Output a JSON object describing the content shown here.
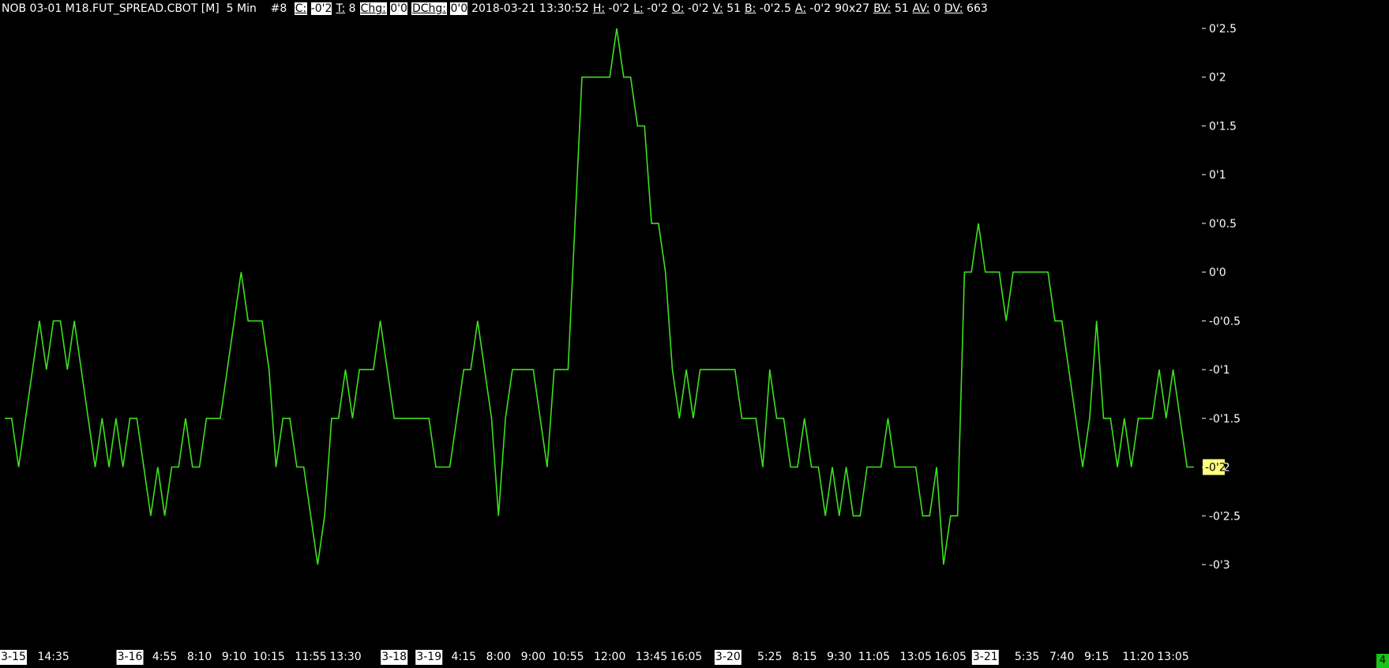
{
  "header": {
    "symbol": "NOB 03-01 M18.FUT_SPREAD.CBOT [M]",
    "interval": "5 Min",
    "bar_num": "#8",
    "items": [
      {
        "label": "C:",
        "value": "-0'2",
        "hl": true
      },
      {
        "label": "T:",
        "value": "8",
        "hl": false
      },
      {
        "label": "Chg:",
        "value": "0'0",
        "hl": true
      },
      {
        "label": "DChg:",
        "value": "0'0",
        "hl": true
      },
      {
        "label": "",
        "value": "2018-03-21 13:30:52",
        "hl": false
      },
      {
        "label": "H:",
        "value": "-0'2",
        "hl": false
      },
      {
        "label": "L:",
        "value": "-0'2",
        "hl": false
      },
      {
        "label": "O:",
        "value": "-0'2",
        "hl": false
      },
      {
        "label": "V:",
        "value": "51",
        "hl": false
      },
      {
        "label": "B:",
        "value": "-0'2.5",
        "hl": false
      },
      {
        "label": "A:",
        "value": "-0'2",
        "hl": false
      },
      {
        "label": "",
        "value": "90x27",
        "hl": false
      },
      {
        "label": "BV:",
        "value": "51",
        "hl": false
      },
      {
        "label": "AV:",
        "value": "0",
        "hl": false
      },
      {
        "label": "DV:",
        "value": "663",
        "hl": false
      }
    ]
  },
  "colors": {
    "line": "#3de01f",
    "background": "#000000",
    "last_price_bg": "#ffff80",
    "badge": "#18c418"
  },
  "badge": "4",
  "chart_data": {
    "type": "line",
    "ylim": [
      -3,
      2.5
    ],
    "y_ticks": [
      {
        "v": 2.5,
        "label": "0'2.5"
      },
      {
        "v": 2,
        "label": "0'2"
      },
      {
        "v": 1.5,
        "label": "0'1.5"
      },
      {
        "v": 1,
        "label": "0'1"
      },
      {
        "v": 0.5,
        "label": "0'0.5"
      },
      {
        "v": 0,
        "label": "0'0"
      },
      {
        "v": -0.5,
        "label": "-0'0.5"
      },
      {
        "v": -1,
        "label": "-0'1"
      },
      {
        "v": -1.5,
        "label": "-0'1.5"
      },
      {
        "v": -2,
        "label": "-0'2"
      },
      {
        "v": -2.5,
        "label": "-0'2.5"
      },
      {
        "v": -3,
        "label": "-0'3"
      }
    ],
    "last_price": {
      "v": -2,
      "label": "-0'2"
    },
    "x_labels": [
      {
        "i": 0,
        "label": "3-15",
        "date": true
      },
      {
        "i": 7,
        "label": "14:35",
        "date": false
      },
      {
        "i": 18,
        "label": "3-16",
        "date": true
      },
      {
        "i": 23,
        "label": "4:55",
        "date": false
      },
      {
        "i": 28,
        "label": "8:10",
        "date": false
      },
      {
        "i": 33,
        "label": "9:10",
        "date": false
      },
      {
        "i": 38,
        "label": "10:15",
        "date": false
      },
      {
        "i": 44,
        "label": "11:55",
        "date": false
      },
      {
        "i": 49,
        "label": "13:30",
        "date": false
      },
      {
        "i": 56,
        "label": "3-18",
        "date": true
      },
      {
        "i": 61,
        "label": "3-19",
        "date": true
      },
      {
        "i": 66,
        "label": "4:15",
        "date": false
      },
      {
        "i": 71,
        "label": "8:00",
        "date": false
      },
      {
        "i": 76,
        "label": "9:00",
        "date": false
      },
      {
        "i": 81,
        "label": "10:55",
        "date": false
      },
      {
        "i": 87,
        "label": "12:00",
        "date": false
      },
      {
        "i": 93,
        "label": "13:45",
        "date": false
      },
      {
        "i": 98,
        "label": "16:05",
        "date": false
      },
      {
        "i": 104,
        "label": "3-20",
        "date": true
      },
      {
        "i": 110,
        "label": "5:25",
        "date": false
      },
      {
        "i": 115,
        "label": "8:15",
        "date": false
      },
      {
        "i": 120,
        "label": "9:30",
        "date": false
      },
      {
        "i": 125,
        "label": "11:05",
        "date": false
      },
      {
        "i": 131,
        "label": "13:05",
        "date": false
      },
      {
        "i": 136,
        "label": "16:05",
        "date": false
      },
      {
        "i": 141,
        "label": "3-21",
        "date": true
      },
      {
        "i": 147,
        "label": "5:35",
        "date": false
      },
      {
        "i": 152,
        "label": "7:40",
        "date": false
      },
      {
        "i": 157,
        "label": "9:15",
        "date": false
      },
      {
        "i": 163,
        "label": "11:20",
        "date": false
      },
      {
        "i": 168,
        "label": "13:05",
        "date": false
      }
    ],
    "series": [
      {
        "values": [
          -1.5,
          -1.5,
          -2,
          -1.5,
          -1,
          -0.5,
          -1,
          -0.5,
          -0.5,
          -1,
          -0.5,
          -1,
          -1.5,
          -2,
          -1.5,
          -2,
          -1.5,
          -2,
          -1.5,
          -1.5,
          -2,
          -2.5,
          -2,
          -2.5,
          -2,
          -2,
          -1.5,
          -2,
          -2,
          -1.5,
          -1.5,
          -1.5,
          -1,
          -0.5,
          0,
          -0.5,
          -0.5,
          -0.5,
          -1,
          -2,
          -1.5,
          -1.5,
          -2,
          -2,
          -2.5,
          -3,
          -2.5,
          -1.5,
          -1.5,
          -1,
          -1.5,
          -1,
          -1,
          -1,
          -0.5,
          -1,
          -1.5,
          -1.5,
          -1.5,
          -1.5,
          -1.5,
          -1.5,
          -2,
          -2,
          -2,
          -1.5,
          -1,
          -1,
          -0.5,
          -1,
          -1.5,
          -2.5,
          -1.5,
          -1,
          -1,
          -1,
          -1,
          -1.5,
          -2,
          -1,
          -1,
          -1,
          0.5,
          2,
          2,
          2,
          2,
          2,
          2.5,
          2,
          2,
          1.5,
          1.5,
          0.5,
          0.5,
          0,
          -1,
          -1.5,
          -1,
          -1.5,
          -1,
          -1,
          -1,
          -1,
          -1,
          -1,
          -1.5,
          -1.5,
          -1.5,
          -2,
          -1,
          -1.5,
          -1.5,
          -2,
          -2,
          -1.5,
          -2,
          -2,
          -2.5,
          -2,
          -2.5,
          -2,
          -2.5,
          -2.5,
          -2,
          -2,
          -2,
          -1.5,
          -2,
          -2,
          -2,
          -2,
          -2.5,
          -2.5,
          -2,
          -3,
          -2.5,
          -2.5,
          0,
          0,
          0.5,
          0,
          0,
          0,
          -0.5,
          0,
          0,
          0,
          0,
          0,
          0,
          -0.5,
          -0.5,
          -1,
          -1.5,
          -2,
          -1.5,
          -0.5,
          -1.5,
          -1.5,
          -2,
          -1.5,
          -2,
          -1.5,
          -1.5,
          -1.5,
          -1,
          -1.5,
          -1,
          -1.5,
          -2,
          -2
        ]
      }
    ]
  }
}
